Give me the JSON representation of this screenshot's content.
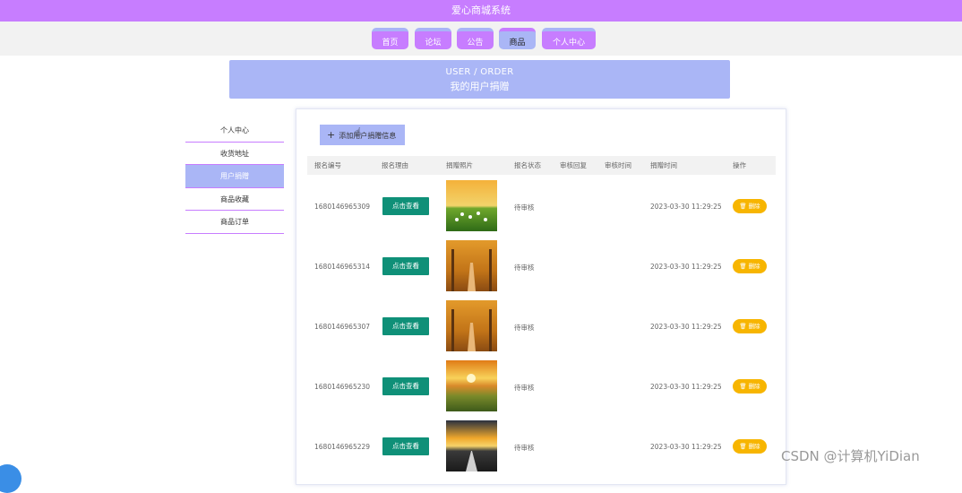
{
  "header": {
    "title": "爱心商城系统"
  },
  "nav": [
    {
      "label": "首页"
    },
    {
      "label": "论坛"
    },
    {
      "label": "公告"
    },
    {
      "label": "商品"
    },
    {
      "label": "个人中心"
    }
  ],
  "banner": {
    "line1": "USER / ORDER",
    "line2": "我的用户捐赠"
  },
  "sidebar": [
    {
      "label": "个人中心"
    },
    {
      "label": "收货地址"
    },
    {
      "label": "用户捐赠"
    },
    {
      "label": "商品收藏"
    },
    {
      "label": "商品订单"
    }
  ],
  "toolbar": {
    "add_label": "添加用户捐赠信息"
  },
  "table": {
    "headers": [
      "报名编号",
      "报名理由",
      "捐赠照片",
      "报名状态",
      "审核回复",
      "审核时间",
      "捐赠时间",
      "操作"
    ],
    "view_label": "点击查看",
    "delete_label": "删除",
    "rows": [
      {
        "id": "1680146965309",
        "status": "待审核",
        "time": "2023-03-30 11:29:25",
        "photo": "daisy-meadow"
      },
      {
        "id": "1680146965314",
        "status": "待审核",
        "time": "2023-03-30 11:29:25",
        "photo": "autumn-avenue"
      },
      {
        "id": "1680146965307",
        "status": "待审核",
        "time": "2023-03-30 11:29:25",
        "photo": "autumn-avenue"
      },
      {
        "id": "1680146965230",
        "status": "待审核",
        "time": "2023-03-30 11:29:25",
        "photo": "sunset-grass"
      },
      {
        "id": "1680146965229",
        "status": "待审核",
        "time": "2023-03-30 11:29:25",
        "photo": "sunset-road"
      }
    ]
  },
  "watermark": "CSDN @计算机YiDian",
  "colors": {
    "accent": "#c77dff",
    "secondary": "#aab6f6",
    "view_button": "#0f9078",
    "delete_button": "#f7b500"
  }
}
